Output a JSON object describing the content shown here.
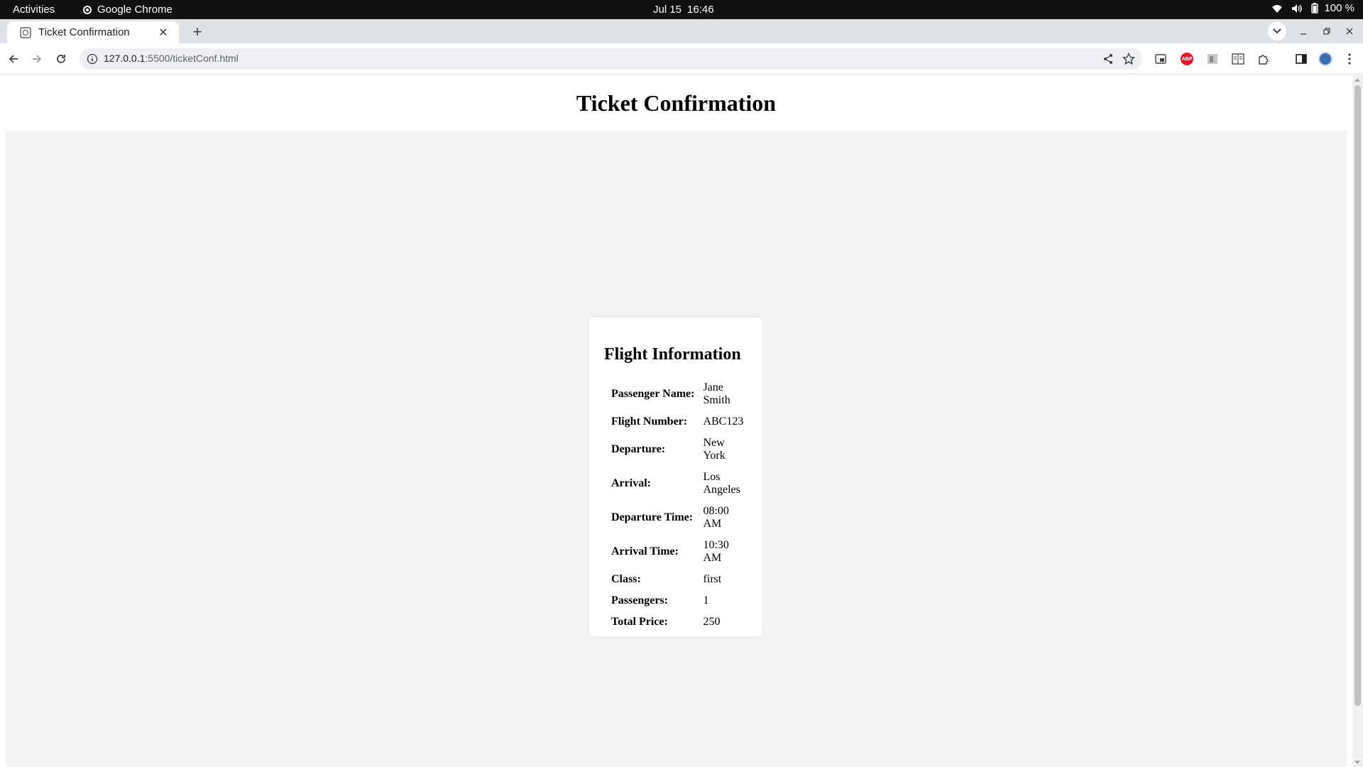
{
  "system_bar": {
    "activities": "Activities",
    "app_name": "Google Chrome",
    "date": "Jul 15",
    "time": "16:46",
    "battery": "100 %"
  },
  "browser": {
    "tab_title": "Ticket Confirmation",
    "url_host": "127.0.0.1",
    "url_path": ":5500/ticketConf.html",
    "extensions": [
      "cast-icon",
      "adblock-plus-icon",
      "extension-icon",
      "reader-icon",
      "puzzle-icon",
      "sidepanel-icon",
      "profile-avatar"
    ],
    "abp_label": "ABP"
  },
  "page": {
    "title": "Ticket Confirmation",
    "card_title": "Flight Information",
    "rows": [
      {
        "label": "Passenger Name:",
        "value": "Jane Smith"
      },
      {
        "label": "Flight Number:",
        "value": "ABC123"
      },
      {
        "label": "Departure:",
        "value": "New York"
      },
      {
        "label": "Arrival:",
        "value": "Los Angeles"
      },
      {
        "label": "Departure Time:",
        "value": "08:00 AM"
      },
      {
        "label": "Arrival Time:",
        "value": "10:30 AM"
      },
      {
        "label": "Class:",
        "value": "first"
      },
      {
        "label": "Passengers:",
        "value": "1"
      },
      {
        "label": "Total Price:",
        "value": "250"
      }
    ]
  },
  "colors": {
    "topbar": "#111111",
    "tabstrip": "#dfe3e8",
    "content_bg": "#f4f4f4",
    "card_bg": "#ffffff"
  }
}
